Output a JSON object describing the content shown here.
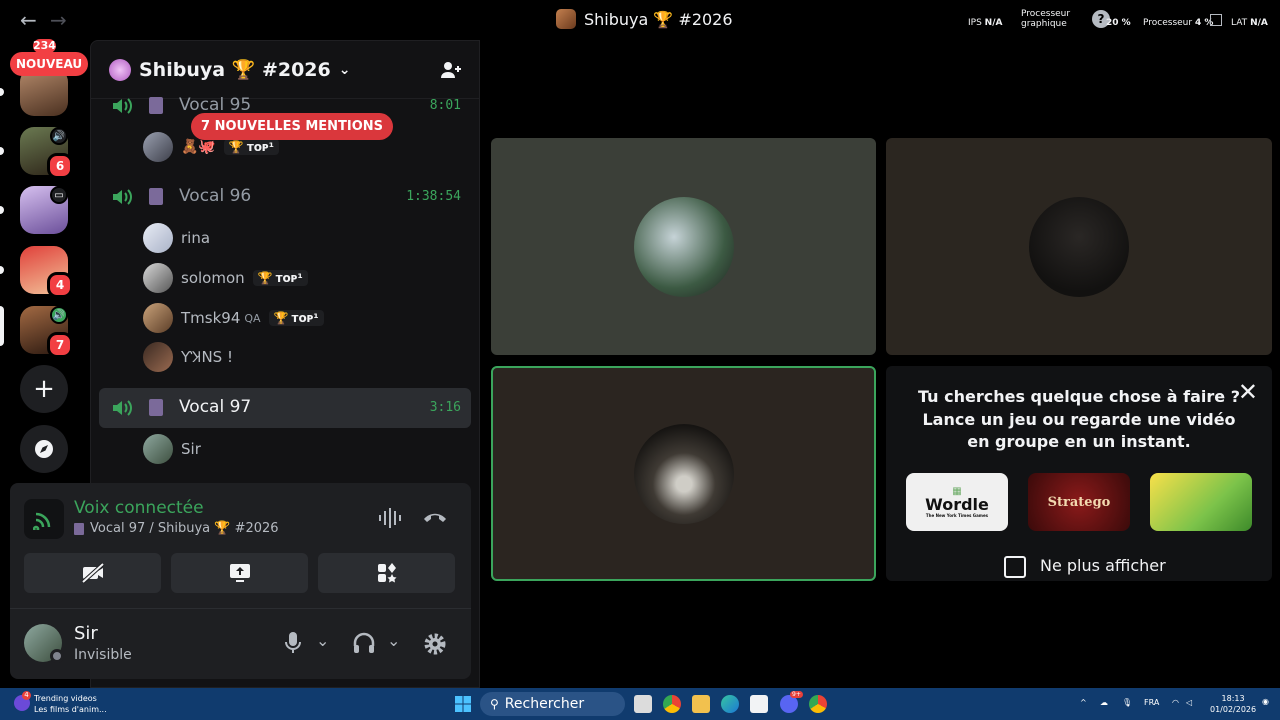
{
  "titlebar": {
    "title": "Shibuya 🏆 #2026",
    "back_icon": "arrow-left-icon",
    "forward_icon": "arrow-right-icon"
  },
  "overlay": {
    "ips_label": "IPS",
    "ips_value": "N/A",
    "gpu_label_1": "Processeur",
    "gpu_label_2": "graphique",
    "gpu_value": "20 %",
    "cpu_label": "Processeur",
    "cpu_value": "4 %",
    "lat_label": "LAT",
    "lat_value": "N/A"
  },
  "servers": {
    "top_badge": "234",
    "nouveau": "NOUVEAU",
    "items": [
      {
        "badge": "",
        "icon": ""
      },
      {
        "badge": "6",
        "icon": "speaker-icon"
      },
      {
        "badge": "",
        "icon": "screen-icon"
      },
      {
        "badge": "4",
        "icon": ""
      },
      {
        "badge": "7",
        "icon": "speaker-icon"
      }
    ]
  },
  "guild": {
    "name": "Shibuya 🏆 #2026",
    "mentions_label": "7 NOUVELLES MENTIONS",
    "tag_label": "ᴛᴏᴘ¹"
  },
  "voice_channels": [
    {
      "name": "Vocal 95",
      "time": "8:01"
    },
    {
      "name": "Vocal 96",
      "time": "1:38:54"
    },
    {
      "name": "Vocal 97",
      "time": "3:16"
    }
  ],
  "members": {
    "vocal96": [
      {
        "name": "rina",
        "tag": "",
        "extra": ""
      },
      {
        "name": "solomon",
        "tag": "ᴛᴏᴘ¹",
        "extra": ""
      },
      {
        "name": "Tmsk94",
        "tag": "ᴛᴏᴘ¹",
        "extra": "QA"
      },
      {
        "name": "ƳꞰNS !",
        "tag": "",
        "extra": ""
      }
    ],
    "vocal97": [
      {
        "name": "Sir"
      }
    ]
  },
  "voice_panel": {
    "status": "Voix connectée",
    "location": "Vocal 97 / Shibuya 🏆 #2026"
  },
  "user": {
    "name": "Sir",
    "status": "Invisible"
  },
  "activity": {
    "prompt": "Tu cherches quelque chose à faire ? Lance un jeu ou regarde une vidéo en groupe en un instant.",
    "games": [
      "Wordle",
      "Stratego",
      ""
    ],
    "wordle_sub": "The New York Times Games",
    "checkbox_label": "Ne plus afficher"
  },
  "taskbar": {
    "news_title": "Trending videos",
    "news_sub": "Les films d'anim...",
    "news_badge": "4",
    "search": "Rechercher",
    "lang": "FRA",
    "time": "18:13",
    "date": "01/02/2026",
    "discord_badge": "9+"
  },
  "colors": {
    "accent_green": "#3ba55c",
    "danger_red": "#f23f43",
    "panel": "#1e1f22"
  }
}
